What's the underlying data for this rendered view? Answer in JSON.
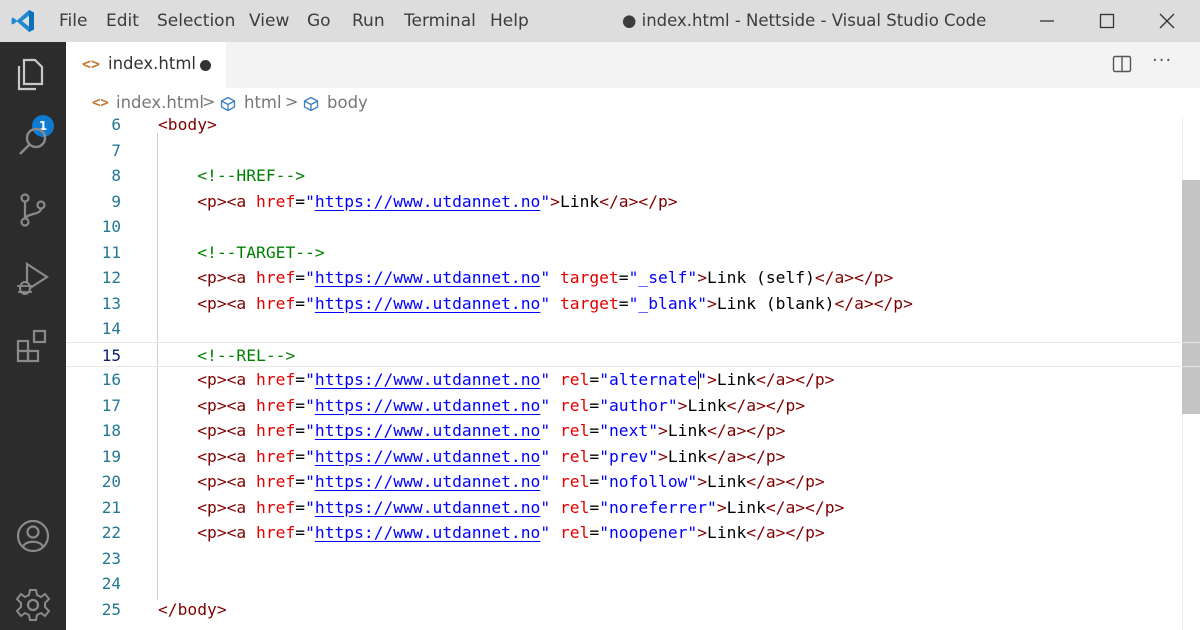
{
  "window": {
    "title": "● index.html - Nettside - Visual Studio Code"
  },
  "menu": [
    "File",
    "Edit",
    "Selection",
    "View",
    "Go",
    "Run",
    "Terminal",
    "Help"
  ],
  "activity_bar": {
    "explorer_badge": "1",
    "icons": [
      "explorer-icon",
      "search-icon",
      "source-control-icon",
      "run-debug-icon",
      "extensions-icon",
      "account-icon",
      "settings-gear-icon"
    ]
  },
  "tab": {
    "icon": "<>",
    "label": "index.html"
  },
  "breadcrumb": {
    "file": "index.html",
    "item1": "html",
    "item2": "body",
    "separator": ">"
  },
  "editor": {
    "lines": [
      {
        "n": "6",
        "tokens": [
          [
            "tag",
            "<body>"
          ]
        ]
      },
      {
        "n": "7",
        "tokens": []
      },
      {
        "n": "8",
        "tokens": [
          [
            "ws",
            "    "
          ],
          [
            "cmt",
            "<!--HREF-->"
          ]
        ]
      },
      {
        "n": "9",
        "tokens": [
          [
            "ws",
            "    "
          ],
          [
            "tag",
            "<p><a "
          ],
          [
            "attr",
            "href"
          ],
          [
            "txt",
            "="
          ],
          [
            "str",
            "\""
          ],
          [
            "url",
            "https://www.utdannet.no"
          ],
          [
            "str",
            "\""
          ],
          [
            "tag",
            ">"
          ],
          [
            "txt",
            "Link"
          ],
          [
            "tag",
            "</a></p>"
          ]
        ]
      },
      {
        "n": "10",
        "tokens": []
      },
      {
        "n": "11",
        "tokens": [
          [
            "ws",
            "    "
          ],
          [
            "cmt",
            "<!--TARGET-->"
          ]
        ]
      },
      {
        "n": "12",
        "tokens": [
          [
            "ws",
            "    "
          ],
          [
            "tag",
            "<p><a "
          ],
          [
            "attr",
            "href"
          ],
          [
            "txt",
            "="
          ],
          [
            "str",
            "\""
          ],
          [
            "url",
            "https://www.utdannet.no"
          ],
          [
            "str",
            "\""
          ],
          [
            "txt",
            " "
          ],
          [
            "attr",
            "target"
          ],
          [
            "txt",
            "="
          ],
          [
            "str",
            "\"_self\""
          ],
          [
            "tag",
            ">"
          ],
          [
            "txt",
            "Link (self)"
          ],
          [
            "tag",
            "</a></p>"
          ]
        ]
      },
      {
        "n": "13",
        "tokens": [
          [
            "ws",
            "    "
          ],
          [
            "tag",
            "<p><a "
          ],
          [
            "attr",
            "href"
          ],
          [
            "txt",
            "="
          ],
          [
            "str",
            "\""
          ],
          [
            "url",
            "https://www.utdannet.no"
          ],
          [
            "str",
            "\""
          ],
          [
            "txt",
            " "
          ],
          [
            "attr",
            "target"
          ],
          [
            "txt",
            "="
          ],
          [
            "str",
            "\"_blank\""
          ],
          [
            "tag",
            ">"
          ],
          [
            "txt",
            "Link (blank)"
          ],
          [
            "tag",
            "</a></p>"
          ]
        ]
      },
      {
        "n": "14",
        "tokens": []
      },
      {
        "n": "15",
        "tokens": [
          [
            "ws",
            "    "
          ],
          [
            "cmt",
            "<!--REL-->"
          ]
        ],
        "current": true
      },
      {
        "n": "16",
        "tokens": [
          [
            "ws",
            "    "
          ],
          [
            "tag",
            "<p><a "
          ],
          [
            "attr",
            "href"
          ],
          [
            "txt",
            "="
          ],
          [
            "str",
            "\""
          ],
          [
            "url",
            "https://www.utdannet.no"
          ],
          [
            "str",
            "\""
          ],
          [
            "txt",
            " "
          ],
          [
            "attr",
            "rel"
          ],
          [
            "txt",
            "="
          ],
          [
            "str",
            "\"alternate\""
          ],
          [
            "tag",
            ">"
          ],
          [
            "txt",
            "Link"
          ],
          [
            "tag",
            "</a></p>"
          ]
        ]
      },
      {
        "n": "17",
        "tokens": [
          [
            "ws",
            "    "
          ],
          [
            "tag",
            "<p><a "
          ],
          [
            "attr",
            "href"
          ],
          [
            "txt",
            "="
          ],
          [
            "str",
            "\""
          ],
          [
            "url",
            "https://www.utdannet.no"
          ],
          [
            "str",
            "\""
          ],
          [
            "txt",
            " "
          ],
          [
            "attr",
            "rel"
          ],
          [
            "txt",
            "="
          ],
          [
            "str",
            "\"author\""
          ],
          [
            "tag",
            ">"
          ],
          [
            "txt",
            "Link"
          ],
          [
            "tag",
            "</a></p>"
          ]
        ]
      },
      {
        "n": "18",
        "tokens": [
          [
            "ws",
            "    "
          ],
          [
            "tag",
            "<p><a "
          ],
          [
            "attr",
            "href"
          ],
          [
            "txt",
            "="
          ],
          [
            "str",
            "\""
          ],
          [
            "url",
            "https://www.utdannet.no"
          ],
          [
            "str",
            "\""
          ],
          [
            "txt",
            " "
          ],
          [
            "attr",
            "rel"
          ],
          [
            "txt",
            "="
          ],
          [
            "str",
            "\"next\""
          ],
          [
            "tag",
            ">"
          ],
          [
            "txt",
            "Link"
          ],
          [
            "tag",
            "</a></p>"
          ]
        ]
      },
      {
        "n": "19",
        "tokens": [
          [
            "ws",
            "    "
          ],
          [
            "tag",
            "<p><a "
          ],
          [
            "attr",
            "href"
          ],
          [
            "txt",
            "="
          ],
          [
            "str",
            "\""
          ],
          [
            "url",
            "https://www.utdannet.no"
          ],
          [
            "str",
            "\""
          ],
          [
            "txt",
            " "
          ],
          [
            "attr",
            "rel"
          ],
          [
            "txt",
            "="
          ],
          [
            "str",
            "\"prev\""
          ],
          [
            "tag",
            ">"
          ],
          [
            "txt",
            "Link"
          ],
          [
            "tag",
            "</a></p>"
          ]
        ]
      },
      {
        "n": "20",
        "tokens": [
          [
            "ws",
            "    "
          ],
          [
            "tag",
            "<p><a "
          ],
          [
            "attr",
            "href"
          ],
          [
            "txt",
            "="
          ],
          [
            "str",
            "\""
          ],
          [
            "url",
            "https://www.utdannet.no"
          ],
          [
            "str",
            "\""
          ],
          [
            "txt",
            " "
          ],
          [
            "attr",
            "rel"
          ],
          [
            "txt",
            "="
          ],
          [
            "str",
            "\"nofollow\""
          ],
          [
            "tag",
            ">"
          ],
          [
            "txt",
            "Link"
          ],
          [
            "tag",
            "</a></p>"
          ]
        ]
      },
      {
        "n": "21",
        "tokens": [
          [
            "ws",
            "    "
          ],
          [
            "tag",
            "<p><a "
          ],
          [
            "attr",
            "href"
          ],
          [
            "txt",
            "="
          ],
          [
            "str",
            "\""
          ],
          [
            "url",
            "https://www.utdannet.no"
          ],
          [
            "str",
            "\""
          ],
          [
            "txt",
            " "
          ],
          [
            "attr",
            "rel"
          ],
          [
            "txt",
            "="
          ],
          [
            "str",
            "\"noreferrer\""
          ],
          [
            "tag",
            ">"
          ],
          [
            "txt",
            "Link"
          ],
          [
            "tag",
            "</a></p>"
          ]
        ]
      },
      {
        "n": "22",
        "tokens": [
          [
            "ws",
            "    "
          ],
          [
            "tag",
            "<p><a "
          ],
          [
            "attr",
            "href"
          ],
          [
            "txt",
            "="
          ],
          [
            "str",
            "\""
          ],
          [
            "url",
            "https://www.utdannet.no"
          ],
          [
            "str",
            "\""
          ],
          [
            "txt",
            " "
          ],
          [
            "attr",
            "rel"
          ],
          [
            "txt",
            "="
          ],
          [
            "str",
            "\"noopener\""
          ],
          [
            "tag",
            ">"
          ],
          [
            "txt",
            "Link"
          ],
          [
            "tag",
            "</a></p>"
          ]
        ]
      },
      {
        "n": "23",
        "tokens": []
      },
      {
        "n": "24",
        "tokens": []
      },
      {
        "n": "25",
        "tokens": [
          [
            "tag",
            "</body>"
          ]
        ]
      }
    ]
  },
  "colors": {
    "activity_bar": "#2c2c2c",
    "title_bar": "#dddddd",
    "badge": "#0e7bd2",
    "tag": "#800000",
    "attribute": "#e50000",
    "string": "#0000ff",
    "comment": "#008000",
    "line_number": "#237893"
  }
}
